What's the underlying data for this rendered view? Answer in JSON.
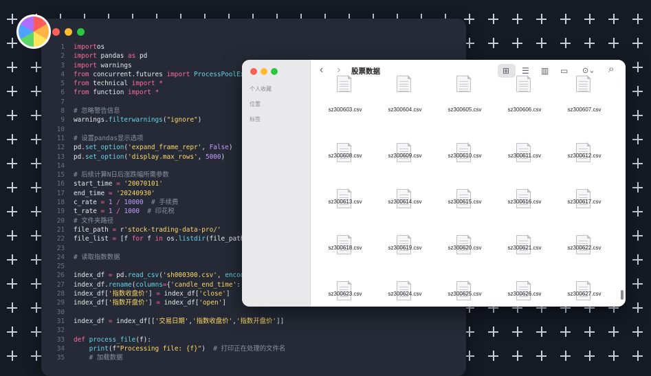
{
  "editor": {
    "code_lines": [
      {
        "n": "1",
        "segs": [
          [
            "kw",
            "import"
          ],
          [
            "",
            "os"
          ]
        ]
      },
      {
        "n": "2",
        "segs": [
          [
            "kw",
            "import"
          ],
          [
            "",
            " pandas "
          ],
          [
            "kw",
            "as"
          ],
          [
            "",
            " pd"
          ]
        ]
      },
      {
        "n": "3",
        "segs": [
          [
            "kw",
            "import"
          ],
          [
            "",
            " warnings"
          ]
        ]
      },
      {
        "n": "4",
        "segs": [
          [
            "kw",
            "from"
          ],
          [
            "",
            " concurrent.futures "
          ],
          [
            "kw",
            "import"
          ],
          [
            "fn",
            " ProcessPoolExecutor"
          ]
        ]
      },
      {
        "n": "5",
        "segs": [
          [
            "kw",
            "from"
          ],
          [
            "",
            " technical "
          ],
          [
            "kw",
            "import"
          ],
          [
            "",
            " "
          ],
          [
            "kw",
            "*"
          ]
        ]
      },
      {
        "n": "6",
        "segs": [
          [
            "kw",
            "from"
          ],
          [
            "",
            " function "
          ],
          [
            "kw",
            "import"
          ],
          [
            "",
            " "
          ],
          [
            "kw",
            "*"
          ]
        ]
      },
      {
        "n": "7",
        "segs": []
      },
      {
        "n": "8",
        "segs": [
          [
            "cm",
            "# 忽略警告信息"
          ]
        ]
      },
      {
        "n": "9",
        "segs": [
          [
            "",
            "warnings."
          ],
          [
            "fn",
            "filterwarnings"
          ],
          [
            "",
            "("
          ],
          [
            "st",
            "\"ignore\""
          ],
          [
            "",
            ")"
          ]
        ]
      },
      {
        "n": "10",
        "segs": []
      },
      {
        "n": "11",
        "segs": [
          [
            "cm",
            "# 设置pandas显示选项"
          ]
        ]
      },
      {
        "n": "12",
        "segs": [
          [
            "",
            "pd."
          ],
          [
            "fn",
            "set_option"
          ],
          [
            "",
            "("
          ],
          [
            "st",
            "'expand_frame_repr'"
          ],
          [
            "",
            ", "
          ],
          [
            "nm",
            "False"
          ],
          [
            "",
            ")"
          ]
        ]
      },
      {
        "n": "13",
        "segs": [
          [
            "",
            "pd."
          ],
          [
            "fn",
            "set_option"
          ],
          [
            "",
            "("
          ],
          [
            "st",
            "'display.max_rows'"
          ],
          [
            "",
            ", "
          ],
          [
            "nm",
            "5000"
          ],
          [
            "",
            ")"
          ]
        ]
      },
      {
        "n": "14",
        "segs": []
      },
      {
        "n": "15",
        "segs": [
          [
            "cm",
            "# 后续计算N日后涨跌幅所需参数"
          ]
        ]
      },
      {
        "n": "16",
        "segs": [
          [
            "",
            "start_time "
          ],
          [
            "kw",
            "="
          ],
          [
            "",
            " "
          ],
          [
            "st",
            "'20070101'"
          ]
        ]
      },
      {
        "n": "17",
        "segs": [
          [
            "",
            "end_time "
          ],
          [
            "kw",
            "="
          ],
          [
            "",
            " "
          ],
          [
            "st",
            "'20240930'"
          ]
        ]
      },
      {
        "n": "18",
        "segs": [
          [
            "",
            "c_rate "
          ],
          [
            "kw",
            "="
          ],
          [
            "",
            " "
          ],
          [
            "nm",
            "1"
          ],
          [
            "",
            " "
          ],
          [
            "kw",
            "/"
          ],
          [
            "",
            " "
          ],
          [
            "nm",
            "10000"
          ],
          [
            "cm",
            "  # 手续费"
          ]
        ]
      },
      {
        "n": "19",
        "segs": [
          [
            "",
            "t_rate "
          ],
          [
            "kw",
            "="
          ],
          [
            "",
            " "
          ],
          [
            "nm",
            "1"
          ],
          [
            "",
            " "
          ],
          [
            "kw",
            "/"
          ],
          [
            "",
            " "
          ],
          [
            "nm",
            "1000"
          ],
          [
            "cm",
            "  # 印花税"
          ]
        ]
      },
      {
        "n": "20",
        "segs": [
          [
            "cm",
            "# 文件夹路径"
          ]
        ]
      },
      {
        "n": "21",
        "segs": [
          [
            "",
            "file_path "
          ],
          [
            "kw",
            "="
          ],
          [
            "",
            " r"
          ],
          [
            "st",
            "'stock-trading-data-pro/'"
          ]
        ]
      },
      {
        "n": "22",
        "segs": [
          [
            "",
            "file_list "
          ],
          [
            "kw",
            "="
          ],
          [
            "",
            " [f "
          ],
          [
            "kw",
            "for"
          ],
          [
            "",
            " f "
          ],
          [
            "kw",
            "in"
          ],
          [
            "",
            " os."
          ],
          [
            "fn",
            "listdir"
          ],
          [
            "",
            "(file_path)"
          ]
        ]
      },
      {
        "n": "23",
        "segs": []
      },
      {
        "n": "24",
        "segs": [
          [
            "cm",
            "# 读取指数数据"
          ]
        ]
      },
      {
        "n": "25",
        "segs": []
      },
      {
        "n": "26",
        "segs": [
          [
            "",
            "index_df "
          ],
          [
            "kw",
            "="
          ],
          [
            "",
            " pd."
          ],
          [
            "fn",
            "read_csv"
          ],
          [
            "",
            "("
          ],
          [
            "st",
            "'sh000300.csv'"
          ],
          [
            "",
            ", "
          ],
          [
            "fn",
            "encoding"
          ]
        ]
      },
      {
        "n": "27",
        "segs": [
          [
            "",
            "index_df."
          ],
          [
            "fn",
            "rename"
          ],
          [
            "",
            "("
          ],
          [
            "fn",
            "columns"
          ],
          [
            "kw",
            "="
          ],
          [
            "",
            "{"
          ],
          [
            "st",
            "'candle_end_time'"
          ],
          [
            "",
            ": "
          ],
          [
            "st",
            "'交"
          ]
        ]
      },
      {
        "n": "28",
        "segs": [
          [
            "",
            "index_df["
          ],
          [
            "st",
            "'指数收盘价'"
          ],
          [
            "",
            "] "
          ],
          [
            "kw",
            "="
          ],
          [
            "",
            " index_df["
          ],
          [
            "st",
            "'close'"
          ],
          [
            "",
            "]"
          ]
        ]
      },
      {
        "n": "29",
        "segs": [
          [
            "",
            "index_df["
          ],
          [
            "st",
            "'指数开盘价'"
          ],
          [
            "",
            "] "
          ],
          [
            "kw",
            "="
          ],
          [
            "",
            " index_df["
          ],
          [
            "st",
            "'open'"
          ],
          [
            "",
            "]"
          ]
        ]
      },
      {
        "n": "30",
        "segs": []
      },
      {
        "n": "31",
        "segs": [
          [
            "",
            "index_df "
          ],
          [
            "kw",
            "="
          ],
          [
            "",
            " index_df[["
          ],
          [
            "st",
            "'交易日期'"
          ],
          [
            "",
            ","
          ],
          [
            "st",
            "'指数收盘价'"
          ],
          [
            "",
            ","
          ],
          [
            "st",
            "'指数开盘价'"
          ],
          [
            "",
            "]]"
          ]
        ]
      },
      {
        "n": "32",
        "segs": []
      },
      {
        "n": "33",
        "segs": [
          [
            "kw",
            "def"
          ],
          [
            "fn",
            " process_file"
          ],
          [
            "",
            "(f):"
          ]
        ]
      },
      {
        "n": "34",
        "segs": [
          [
            "",
            "    "
          ],
          [
            "fn",
            "print"
          ],
          [
            "",
            "(f"
          ],
          [
            "st",
            "\"Processing file: {f}\""
          ],
          [
            "",
            ")  "
          ],
          [
            "cm",
            "# 打印正在处理的文件名"
          ]
        ]
      },
      {
        "n": "35",
        "segs": [
          [
            "",
            "    "
          ],
          [
            "cm",
            "# 加载数据"
          ]
        ]
      }
    ]
  },
  "finder": {
    "title": "股票数据",
    "sidebar": [
      "个人收藏",
      "位置",
      "标签"
    ],
    "toolbar": {
      "back_icon": "‹",
      "forward_icon": "›",
      "grid_icon": "⊞",
      "list_icon": "☰",
      "column_icon": "▥",
      "gallery_icon": "▭",
      "more_icon": "⊙⌄",
      "search_icon": "⌕"
    },
    "files": [
      "sz300603.csv",
      "sz300604.csv",
      "sz300605.csv",
      "sz300606.csv",
      "sz300607.csv",
      "sz300608.csv",
      "sz300609.csv",
      "sz300610.csv",
      "sz300611.csv",
      "sz300612.csv",
      "sz300613.csv",
      "sz300614.csv",
      "sz300615.csv",
      "sz300616.csv",
      "sz300617.csv",
      "sz300618.csv",
      "sz300619.csv",
      "sz300620.csv",
      "sz300621.csv",
      "sz300622.csv",
      "sz300623.csv",
      "sz300624.csv",
      "sz300625.csv",
      "sz300626.csv",
      "sz300627.csv"
    ]
  }
}
